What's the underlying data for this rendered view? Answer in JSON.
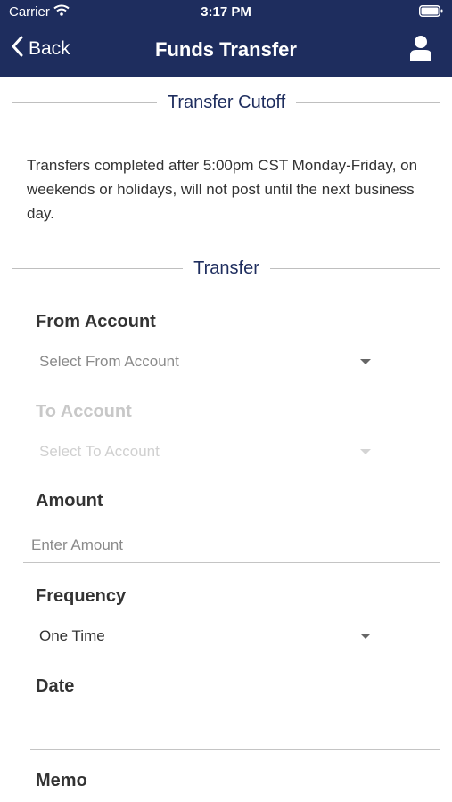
{
  "status_bar": {
    "carrier": "Carrier",
    "time": "3:17 PM",
    "wifi_icon": "wifi-icon",
    "battery_icon": "battery-icon"
  },
  "nav": {
    "back_label": "Back",
    "title": "Funds Transfer",
    "profile_icon": "person-icon"
  },
  "colors": {
    "header_bg": "#1e2d5e",
    "section_title": "#1e2d5e",
    "disabled_text": "#c8c8c8"
  },
  "cutoff_section": {
    "title": "Transfer Cutoff",
    "text": "Transfers completed after 5:00pm CST Monday-Friday, on weekends or holidays, will not post until the next business day."
  },
  "transfer_section": {
    "title": "Transfer",
    "from_account": {
      "label": "From Account",
      "placeholder": "Select From Account"
    },
    "to_account": {
      "label": "To Account",
      "placeholder": "Select To Account",
      "disabled": true
    },
    "amount": {
      "label": "Amount",
      "placeholder": "Enter Amount"
    },
    "frequency": {
      "label": "Frequency",
      "value": "One Time"
    },
    "date": {
      "label": "Date",
      "value": ""
    },
    "memo": {
      "label": "Memo"
    }
  }
}
